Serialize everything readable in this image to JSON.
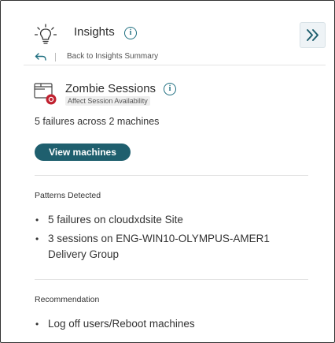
{
  "header": {
    "title": "Insights",
    "info_glyph": "i",
    "collapse_glyph": "»",
    "icons": [
      "lightbulb-icon",
      "info-icon",
      "double-chevron-right-icon"
    ]
  },
  "navigation": {
    "back_label": "Back to Insights Summary",
    "back_icon": "back-arrow-icon"
  },
  "insight": {
    "title": "Zombie Sessions",
    "impact": "Affect Session Availability",
    "summary": "5 failures across 2 machines",
    "action_label": "View machines",
    "icon": "zombie-session-icon",
    "alert_color": "#c0202f"
  },
  "patterns": {
    "heading": "Patterns Detected",
    "items": [
      "5 failures on cloudxdsite Site",
      "3 sessions on ENG-WIN10-OLYMPUS-AMER1 Delivery Group"
    ]
  },
  "recommendation": {
    "heading": "Recommendation",
    "items": [
      "Log off users/Reboot machines"
    ]
  },
  "colors": {
    "accent": "#1f5f6e",
    "info": "#1f6f80"
  }
}
